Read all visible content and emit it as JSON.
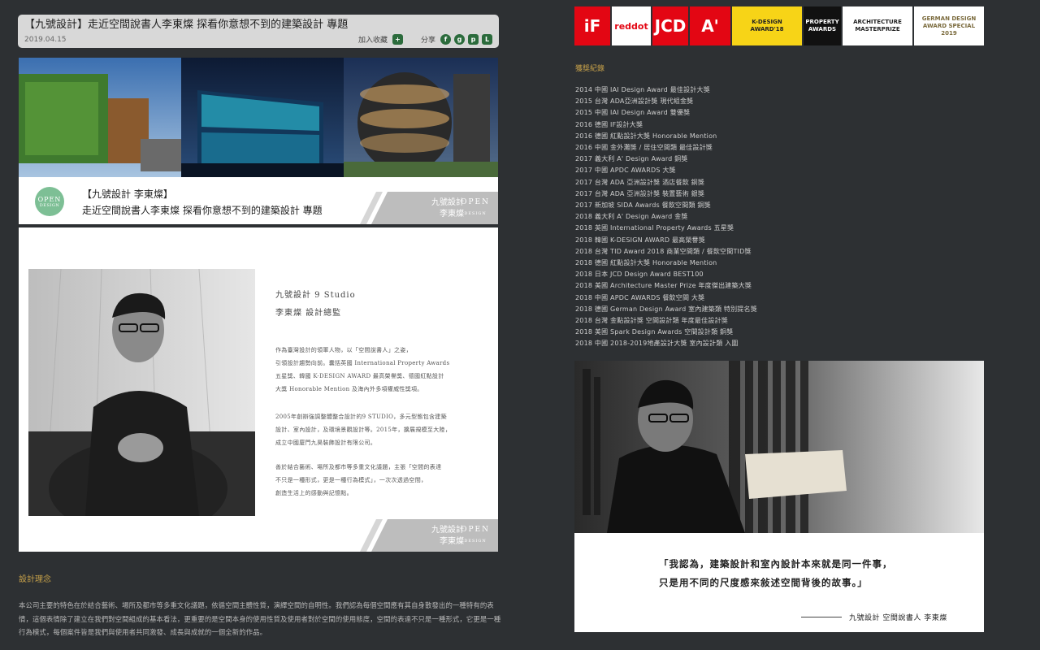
{
  "article": {
    "title": "【九號設計】走近空間說書人李東燦 探看你意想不到的建築設計 專題",
    "date": "2019.04.15",
    "bookmark_label": "加入收藏",
    "share_label": "分享",
    "share_icons": [
      "bookmark-icon",
      "facebook-icon",
      "googleplus-icon",
      "plurk-icon",
      "line-icon"
    ]
  },
  "banner": {
    "logo_text": "OPEN",
    "logo_sub": "DESIGN",
    "caption_line1": "【九號設計 李東燦】",
    "caption_line2": "走近空間說書人李東燦 探看你意想不到的建築設計 專題",
    "badge_line1": "九號設計",
    "badge_line2": "李東燦",
    "badge_open": "OPEN",
    "badge_design": "DESIGN"
  },
  "profile": {
    "studio": "九號設計 9 Studio",
    "title": "李東燦 設計總監",
    "bio1": [
      "作為臺灣設計的領軍人物，以「空間說書人」之姿，",
      "引領設計趨勢向前。囊括英國 International Property Awards",
      "五星獎、韓國 K-DESIGN AWARD 最高榮譽獎、德國紅點設計",
      "大獎 Honorable Mention 及海內外多項權威性獎項。"
    ],
    "bio2": [
      "2005年創辦強調整體整合設計的9 STUDIO，多元型態包含建築",
      "設計、室內設計，及環境景觀設計等。2015年，擴展規模至大陸，",
      "成立中國廈門九昊裝飾設計有限公司。"
    ],
    "bio3": [
      "善於結合藝術、場所及都市等多重文化議題，主張「空間的表達",
      "不只是一種形式，更是一種行為模式」，一次次透過空間，",
      "創造生活上的感動與記憶點。"
    ],
    "badge_line1": "九號設計",
    "badge_line2": "李東燦",
    "badge_open": "OPEN",
    "badge_design": "DESIGN"
  },
  "concept": {
    "title": "設計理念",
    "body": "本公司主要的特色在於結合藝術、場所及都市等多重文化議題，依循空間主體性質，演繹空間的自明性。我們認為每個空間應有其自身散發出的一種特有的表情，這個表情除了建立在我們對空間組成的基本看法，更重要的是空間本身的使用性質及使用者對於空間的使用態度，空間的表達不只是一種形式，它更是一種行為模式，每個案件皆是我們與使用者共同激發、成長與成就的一個全新的作品。"
  },
  "awards_logos": [
    {
      "text": "iF",
      "bg": "#e30613",
      "fg": "#ffffff",
      "w": 44
    },
    {
      "text": "reddot",
      "bg": "#ffffff",
      "fg": "#e30613",
      "w": 48
    },
    {
      "text": "JCD",
      "bg": "#e30613",
      "fg": "#ffffff",
      "w": 44
    },
    {
      "text": "A'",
      "bg": "#e30613",
      "fg": "#ffffff",
      "w": 50
    },
    {
      "text": "K-DESIGN AWARD'18",
      "bg": "#f7d417",
      "fg": "#222222",
      "w": 86
    },
    {
      "text": "PROPERTY AWARDS",
      "bg": "#111111",
      "fg": "#ffffff",
      "w": 46
    },
    {
      "text": "ARCHITECTURE MASTERPRIZE",
      "bg": "#ffffff",
      "fg": "#222222",
      "w": 86
    },
    {
      "text": "GERMAN DESIGN AWARD SPECIAL 2019",
      "bg": "#ffffff",
      "fg": "#7a6a3c",
      "w": 86
    }
  ],
  "records": {
    "title": "獲獎紀錄",
    "items": [
      "2014 中國 IAI Design Award 最佳設計大獎",
      "2015 台灣 ADA亞洲設計獎 現代組金獎",
      "2015 中國 IAI Design Award 雙優獎",
      "2016 德國 IF設計大獎",
      "2016 德國 紅點設計大獎 Honorable Mention",
      "2016 中國 金外灘獎 / 居住空間類 最佳設計獎",
      "2017 義大利 A' Design Award 銅獎",
      "2017 中國 APDC AWARDS 大獎",
      "2017 台灣 ADA 亞洲設計獎 酒店餐飲 銅獎",
      "2017 台灣 ADA 亞洲設計獎 裝置藝術 銀獎",
      "2017 新加坡 SIDA Awards 餐飲空間類 銅獎",
      "2018 義大利 A' Design Award 金獎",
      "2018 英國 International Property Awards 五星獎",
      "2018 韓國 K-DESIGN AWARD 最高榮譽獎",
      "2018 台灣 TID Award 2018 商業空間類 / 餐飲空間TID獎",
      "2018 德國 紅點設計大獎 Honorable Mention",
      "2018 日本 JCD Design Award BEST100",
      "2018 美國 Architecture Master Prize 年度傑出建築大獎",
      "2018 中國 APDC AWARDS 餐飲空間 大獎",
      "2018 德國 German Design Award 室內建築類 特別提名獎",
      "2018 台灣 金點設計獎 空間設計類 年度最佳設計獎",
      "2018 美國 Spark Design Awards 空間設計類 銅獎",
      "2018 中國 2018-2019地產設計大獎 室內設計類 入圍"
    ]
  },
  "quote": {
    "line1": "「我認為，建築設計和室內設計本來就是同一件事，",
    "line2": "只是用不同的尺度感來敍述空間背後的故事。」",
    "signature": "九號設計 空間說書人 李東燦"
  }
}
